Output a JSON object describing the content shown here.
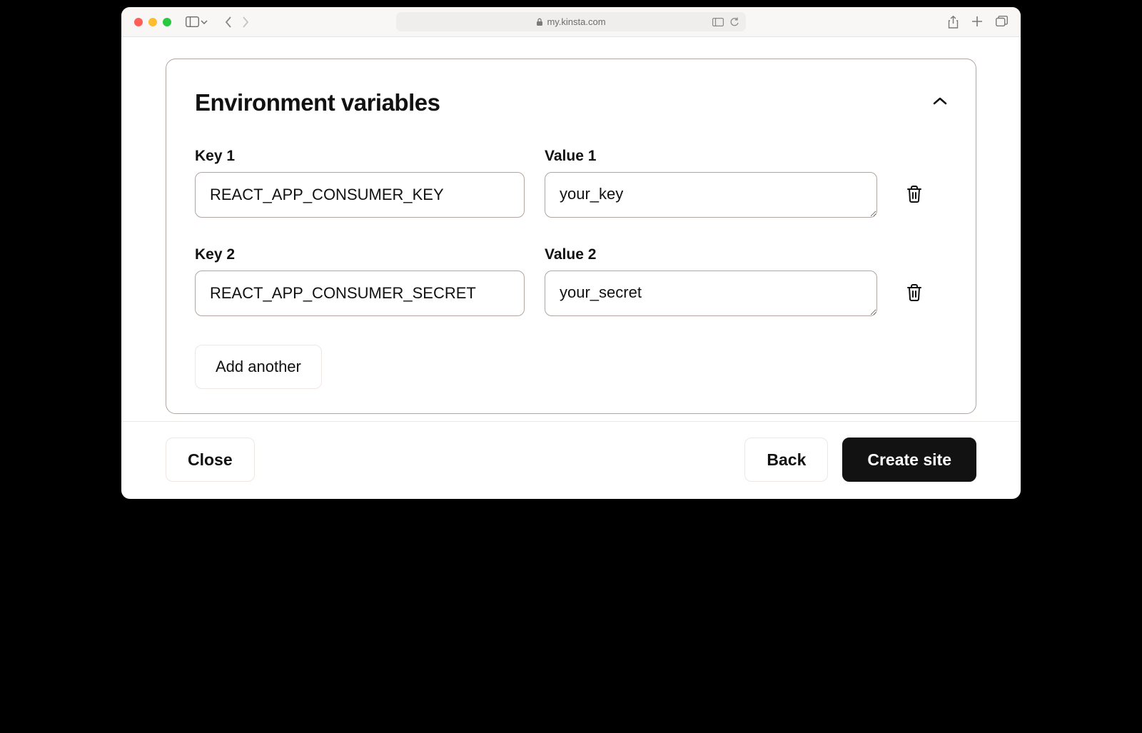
{
  "browser": {
    "url": "my.kinsta.com"
  },
  "panel": {
    "title": "Environment variables",
    "rows": [
      {
        "key_label": "Key 1",
        "key_value": "REACT_APP_CONSUMER_KEY",
        "value_label": "Value 1",
        "value_value": "your_key"
      },
      {
        "key_label": "Key 2",
        "key_value": "REACT_APP_CONSUMER_SECRET",
        "value_label": "Value 2",
        "value_value": "your_secret"
      }
    ],
    "add_another_label": "Add another"
  },
  "footer": {
    "close_label": "Close",
    "back_label": "Back",
    "create_label": "Create site"
  }
}
